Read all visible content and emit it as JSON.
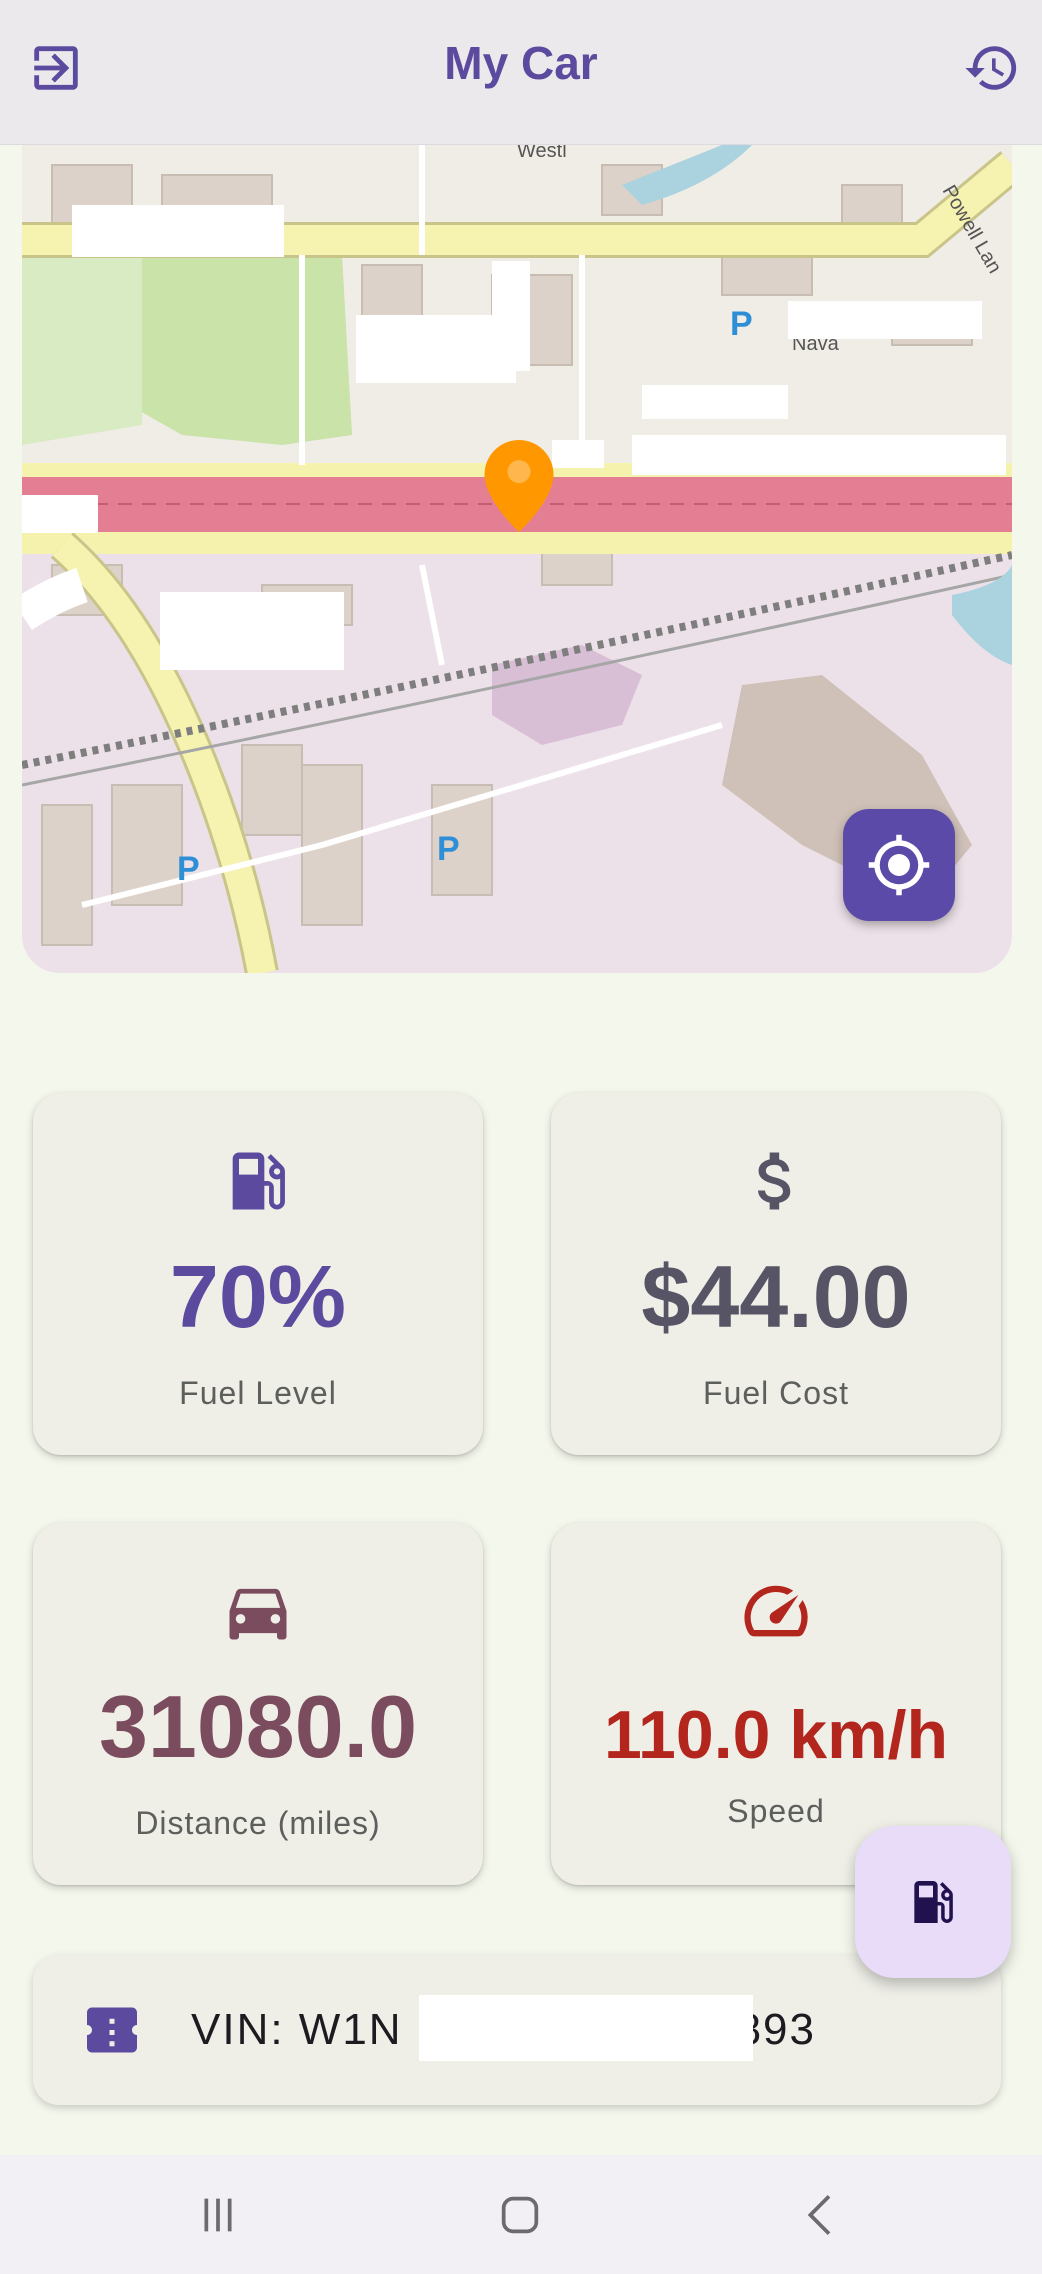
{
  "app_bar": {
    "title": "My Car",
    "left_icon": "logout-icon",
    "right_icon": "history-icon"
  },
  "map": {
    "labels": [
      "Westl",
      "Powell Lan",
      "Nava"
    ],
    "locate_icon": "my-location-icon",
    "marker_icon": "map-pin-icon",
    "colors": {
      "marker": "#ff9800",
      "locate_button": "#5b4aa8"
    }
  },
  "stats": {
    "fuel": {
      "value": "70%",
      "label": "Fuel Level",
      "icon": "gas-station-icon",
      "color": "#5b4a9e"
    },
    "cost": {
      "value": "$44.00",
      "label": "Fuel Cost",
      "icon": "dollar-icon",
      "color": "#575466"
    },
    "distance": {
      "value": "31080.0",
      "label": "Distance (miles)",
      "icon": "car-icon",
      "color": "#7b4b5e"
    },
    "speed": {
      "value": "110.0 km/h",
      "label": "Speed",
      "icon": "speedometer-icon",
      "color": "#b3261e"
    }
  },
  "fab": {
    "icon": "gas-station-icon"
  },
  "vin": {
    "prefix": "VIN: W1N",
    "suffix": "893",
    "icon": "vin-ticket-icon"
  },
  "system_nav": {
    "recent": "recent-apps-icon",
    "home": "home-icon",
    "back": "back-icon"
  }
}
